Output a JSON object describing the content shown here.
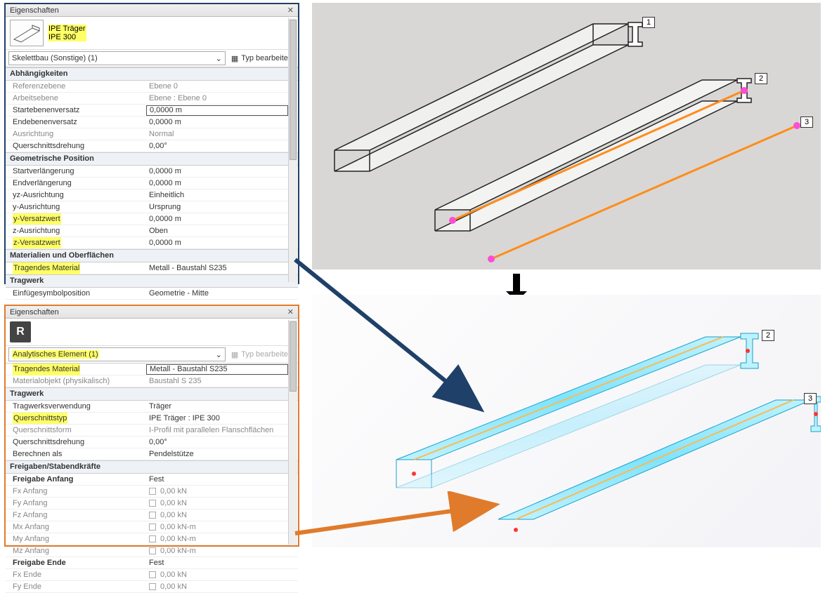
{
  "panel_top": {
    "title": "Eigenschaften",
    "family_name": "IPE Träger",
    "type_name": "IPE 300",
    "filter": "Skelettbau (Sonstige) (1)",
    "edit_type": "Typ bearbeiten",
    "sections": {
      "deps": "Abhängigkeiten",
      "geopos": "Geometrische Position",
      "mat": "Materialien und Oberflächen",
      "trag": "Tragwerk"
    },
    "rows": {
      "refebene_l": "Referenzebene",
      "refebene_v": "Ebene 0",
      "arbeitsebene_l": "Arbeitsebene",
      "arbeitsebene_v": "Ebene : Ebene 0",
      "startversatz_l": "Startebenenversatz",
      "startversatz_v": "0,0000 m",
      "endversatz_l": "Endebenenversatz",
      "endversatz_v": "0,0000 m",
      "ausricht_l": "Ausrichtung",
      "ausricht_v": "Normal",
      "qdrehung_l": "Querschnittsdrehung",
      "qdrehung_v": "0,00°",
      "startverl_l": "Startverlängerung",
      "startverl_v": "0,0000 m",
      "endverl_l": "Endverlängerung",
      "endverl_v": "0,0000 m",
      "yzausr_l": "yz-Ausrichtung",
      "yzausr_v": "Einheitlich",
      "yausr_l": "y-Ausrichtung",
      "yausr_v": "Ursprung",
      "yversatz_l": "y-Versatzwert",
      "yversatz_v": "0,0000 m",
      "zausr_l": "z-Ausrichtung",
      "zausr_v": "Oben",
      "zversatz_l": "z-Versatzwert",
      "zversatz_v": "0,0000 m",
      "tragmat_l": "Tragendes Material",
      "tragmat_v": "Metall - Baustahl S235",
      "einsym_l": "Einfügesymbolposition",
      "einsym_v": "Geometrie - Mitte"
    }
  },
  "panel_bottom": {
    "title": "Eigenschaften",
    "filter": "Analytisches Element (1)",
    "edit_type": "Typ bearbeiten",
    "sections": {
      "trag": "Tragwerk",
      "freigaben": "Freigaben/Stabendkräfte"
    },
    "rows": {
      "tragmat_l": "Tragendes Material",
      "tragmat_v": "Metall - Baustahl S235",
      "matobj_l": "Materialobjekt (physikalisch)",
      "matobj_v": "Baustahl S 235",
      "tragverw_l": "Tragwerksverwendung",
      "tragverw_v": "Träger",
      "qtyp_l": "Querschnittstyp",
      "qtyp_v": "IPE Träger : IPE 300",
      "qform_l": "Querschnittsform",
      "qform_v": "I-Profil mit parallelen Flanschflächen",
      "qdreh_l": "Querschnittsdrehung",
      "qdreh_v": "0,00°",
      "berech_l": "Berechnen als",
      "berech_v": "Pendelstütze",
      "freianf_l": "Freigabe Anfang",
      "freianf_v": "Fest",
      "fxanf_l": "Fx Anfang",
      "fxanf_v": "0,00 kN",
      "fyanf_l": "Fy Anfang",
      "fyanf_v": "0,00 kN",
      "fzanf_l": "Fz Anfang",
      "fzanf_v": "0,00 kN",
      "mxanf_l": "Mx Anfang",
      "mxanf_v": "0,00 kN-m",
      "myanf_l": "My Anfang",
      "myanf_v": "0,00 kN-m",
      "mzanf_l": "Mz Anfang",
      "mzanf_v": "0,00 kN-m",
      "freiend_l": "Freigabe Ende",
      "freiend_v": "Fest",
      "fxend_l": "Fx Ende",
      "fxend_v": "0,00 kN",
      "fyend_l": "Fy Ende",
      "fyend_v": "0,00 kN"
    }
  },
  "tags": {
    "t1": "1",
    "t2": "2",
    "t3": "3"
  }
}
